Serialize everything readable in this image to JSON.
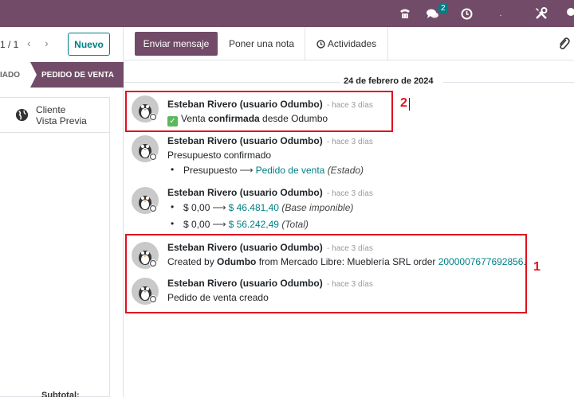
{
  "navbar": {
    "icons": [
      "phone-icon",
      "chat-icon",
      "clock-icon",
      "tools-icon"
    ],
    "chat_badge": "2",
    "dot": "."
  },
  "form": {
    "pager": "1 / 1",
    "new_button": "Nuevo",
    "status_prev": "IADO",
    "status_active": "PEDIDO DE VENTA",
    "customer_label": "Cliente",
    "customer_sub": "Vista Previa",
    "subtotal_label": "Subtotal:"
  },
  "chatter": {
    "send_message": "Enviar mensaje",
    "log_note": "Poner una nota",
    "activities": "Actividades",
    "date_separator": "24 de febrero de 2024",
    "messages": [
      {
        "author": "Esteban Rivero (usuario Odumbo)",
        "date": "- hace 3 días",
        "pre": "Venta ",
        "strong": "confirmada",
        "post": " desde Odumbo"
      },
      {
        "author": "Esteban Rivero (usuario Odumbo)",
        "date": "- hace 3 días",
        "body": "Presupuesto confirmado",
        "tracking": [
          {
            "old": "Presupuesto",
            "new": "Pedido de venta",
            "field": "(Estado)"
          }
        ]
      },
      {
        "author": "Esteban Rivero (usuario Odumbo)",
        "date": "- hace 3 días",
        "tracking": [
          {
            "old": "$ 0,00",
            "new": "$ 46.481,40",
            "field": "(Base imponible)"
          },
          {
            "old": "$ 0,00",
            "new": "$ 56.242,49",
            "field": "(Total)"
          }
        ]
      },
      {
        "author": "Esteban Rivero (usuario Odumbo)",
        "date": "- hace 3 días",
        "pre": "Created by ",
        "strong": "Odumbo",
        "mid": " from Mercado Libre: Mueblería SRL order ",
        "link": "2000007677692856",
        "post": "."
      },
      {
        "author": "Esteban Rivero (usuario Odumbo)",
        "date": "- hace 3 días",
        "body": "Pedido de venta creado"
      }
    ]
  },
  "annotations": {
    "box1": "1",
    "box2": "2"
  },
  "colors": {
    "brand": "#714b67",
    "accent": "#017e84",
    "highlight": "#e0111f"
  }
}
